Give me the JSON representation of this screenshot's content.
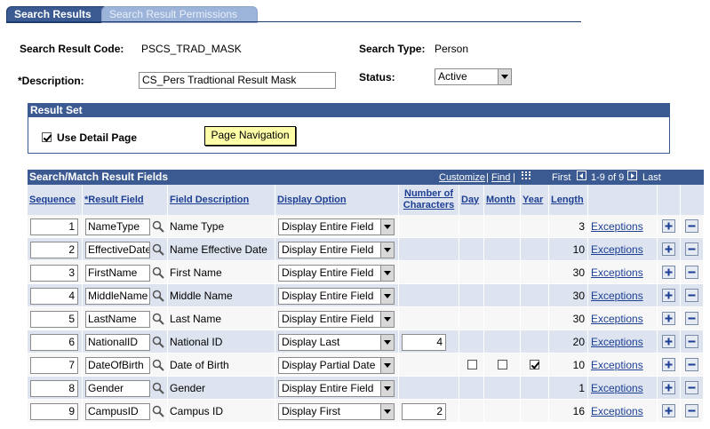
{
  "tabs": {
    "active": "Search Results",
    "inactive": "Search Result Permissions"
  },
  "header": {
    "code_label": "Search Result Code:",
    "code_value": "PSCS_TRAD_MASK",
    "type_label": "Search Type:",
    "type_value": "Person",
    "desc_label": "*Description:",
    "desc_value": "CS_Pers Tradtional Result Mask",
    "status_label": "Status:",
    "status_value": "Active"
  },
  "result_set": {
    "title": "Result Set",
    "use_detail_label": "Use Detail Page",
    "use_detail_checked": true,
    "page_nav_button": "Page Navigation"
  },
  "grid": {
    "title": "Search/Match Result Fields",
    "customize": "Customize",
    "sep1": "|",
    "find": "Find",
    "sep2": "|",
    "first": "First",
    "range": "1-9 of 9",
    "last": "Last",
    "columns": {
      "sequence": "Sequence",
      "result_field": "*Result Field",
      "field_description": "Field Description",
      "display_option": "Display Option",
      "num_chars": "Number of Characters",
      "day": "Day",
      "month": "Month",
      "year": "Year",
      "length": "Length"
    },
    "exceptions_label": "Exceptions",
    "rows": [
      {
        "seq": "1",
        "field": "NameType",
        "desc": "Name Type",
        "option": "Display Entire Field",
        "chars": "",
        "length": "3"
      },
      {
        "seq": "2",
        "field": "EffectiveDate",
        "desc": "Name Effective Date",
        "option": "Display Entire Field",
        "chars": "",
        "length": "10"
      },
      {
        "seq": "3",
        "field": "FirstName",
        "desc": "First Name",
        "option": "Display Entire Field",
        "chars": "",
        "length": "30"
      },
      {
        "seq": "4",
        "field": "MiddleName",
        "desc": "Middle Name",
        "option": "Display Entire Field",
        "chars": "",
        "length": "30"
      },
      {
        "seq": "5",
        "field": "LastName",
        "desc": "Last Name",
        "option": "Display Entire Field",
        "chars": "",
        "length": "30"
      },
      {
        "seq": "6",
        "field": "NationalID",
        "desc": "National ID",
        "option": "Display Last",
        "chars": "4",
        "length": "20"
      },
      {
        "seq": "7",
        "field": "DateOfBirth",
        "desc": "Date of Birth",
        "option": "Display Partial Date",
        "chars": "",
        "length": "10",
        "day": false,
        "month": false,
        "year": true
      },
      {
        "seq": "8",
        "field": "Gender",
        "desc": "Gender",
        "option": "Display Entire Field",
        "chars": "",
        "length": "1"
      },
      {
        "seq": "9",
        "field": "CampusID",
        "desc": "Campus ID",
        "option": "Display First",
        "chars": "2",
        "length": "16"
      }
    ]
  }
}
